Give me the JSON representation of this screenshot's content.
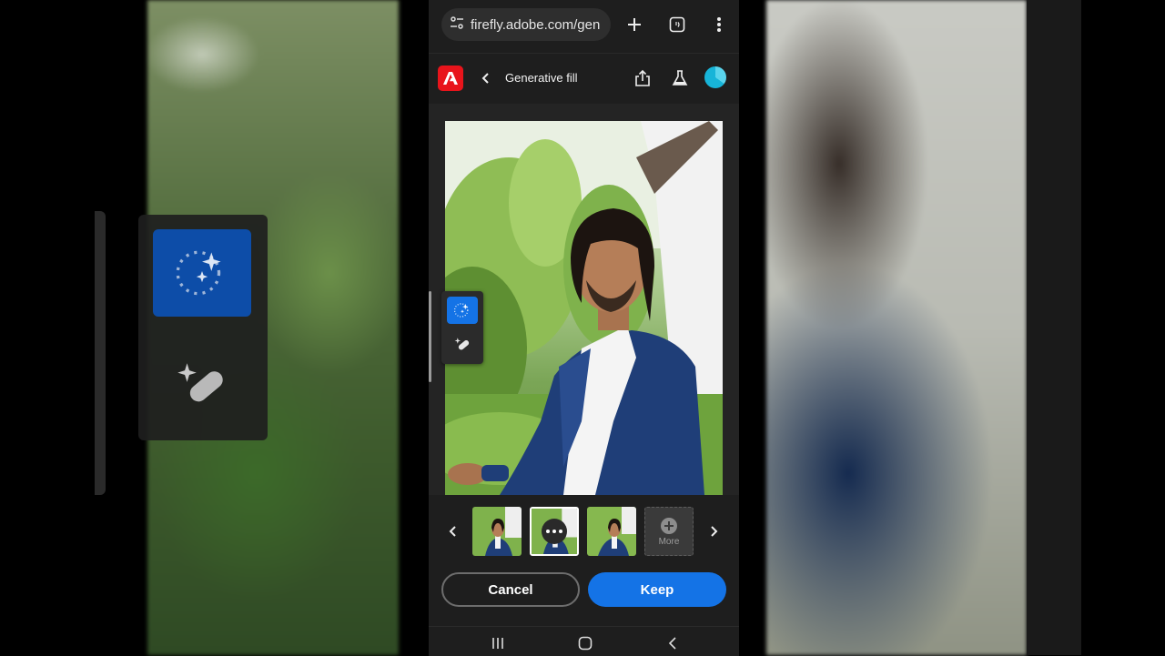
{
  "browser": {
    "url": "firefly.adobe.com/gen"
  },
  "header": {
    "title": "Generative fill"
  },
  "variants": {
    "more_label": "More"
  },
  "actions": {
    "cancel_label": "Cancel",
    "keep_label": "Keep"
  },
  "colors": {
    "accent": "#1473e6",
    "adobe_red": "#e8141b",
    "app_bg": "#1e1e1e"
  },
  "icons": [
    "site-settings-icon",
    "new-tab-icon",
    "tab-switcher-icon",
    "more-vert-icon",
    "adobe-logo",
    "back-chevron-icon",
    "share-icon",
    "beaker-icon",
    "avatar",
    "generative-fill-icon",
    "remove-heal-icon",
    "prev-variant-icon",
    "next-variant-icon",
    "options-dots-icon",
    "plus-circle-icon",
    "recent-apps-icon",
    "home-icon",
    "android-back-icon"
  ]
}
